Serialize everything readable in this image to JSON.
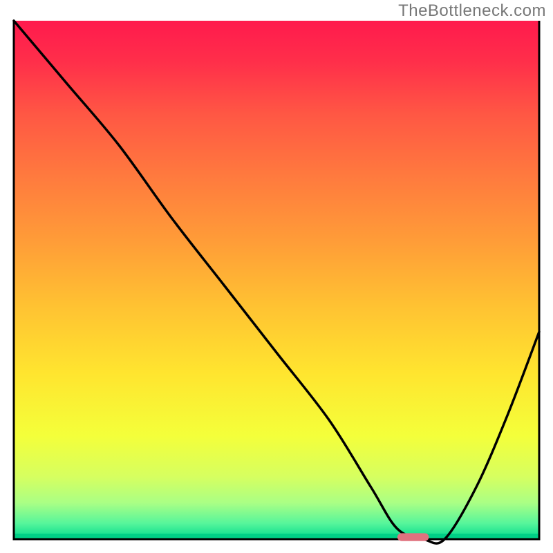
{
  "watermark": "TheBottleneck.com",
  "chart_data": {
    "type": "line",
    "title": "",
    "xlabel": "",
    "ylabel": "",
    "xlim": [
      0,
      100
    ],
    "ylim": [
      0,
      100
    ],
    "grid": false,
    "legend": false,
    "background": {
      "type": "vertical-gradient",
      "stops": [
        {
          "pos": 0.0,
          "color": "#ff1a4d"
        },
        {
          "pos": 0.08,
          "color": "#ff2f4a"
        },
        {
          "pos": 0.18,
          "color": "#ff5744"
        },
        {
          "pos": 0.3,
          "color": "#ff7a3e"
        },
        {
          "pos": 0.42,
          "color": "#ff9b38"
        },
        {
          "pos": 0.55,
          "color": "#ffc232"
        },
        {
          "pos": 0.68,
          "color": "#ffe52f"
        },
        {
          "pos": 0.8,
          "color": "#f4ff3a"
        },
        {
          "pos": 0.88,
          "color": "#d6ff60"
        },
        {
          "pos": 0.93,
          "color": "#aaff85"
        },
        {
          "pos": 0.97,
          "color": "#55f59b"
        },
        {
          "pos": 1.0,
          "color": "#00d98c"
        }
      ]
    },
    "series": [
      {
        "name": "curve",
        "color": "#000000",
        "x": [
          0,
          10,
          20,
          30,
          40,
          50,
          60,
          68,
          73,
          78,
          82,
          88,
          94,
          100
        ],
        "y": [
          100,
          88,
          76,
          62,
          49,
          36,
          23,
          10,
          2,
          0,
          0,
          10,
          24,
          40
        ]
      }
    ],
    "marker": {
      "name": "target-pill",
      "color": "#e0727f",
      "x": 76,
      "y": 0,
      "width": 6,
      "height": 1.5
    },
    "axes_border": {
      "left": true,
      "bottom": true,
      "right": true,
      "color": "#000000"
    }
  }
}
